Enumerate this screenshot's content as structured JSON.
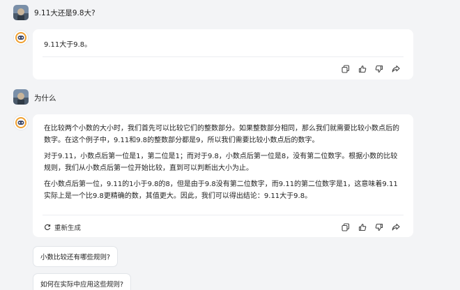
{
  "conversation": {
    "user_question_1": "9.11大还是9.8大?",
    "answer_1": "9.11大于9.8。",
    "user_question_2": "为什么",
    "answer_2": {
      "paragraphs": [
        "在比较两个小数的大小时，我们首先可以比较它们的整数部分。如果整数部分相同，那么我们就需要比较小数点后的数字。在这个例子中，9.11和9.8的整数部分都是9，所以我们需要比较小数点后的数字。",
        "对于9.11，小数点后第一位是1，第二位是1；而对于9.8，小数点后第一位是8，没有第二位数字。根据小数的比较规则，我们从小数点后第一位开始比较，直到可以判断出大小为止。",
        "在小数点后第一位，9.11的1小于9.8的8，但是由于9.8没有第二位数字，而9.11的第二位数字是1，这意味着9.11实际上是一个比9.8更精确的数，其值更大。因此，我们可以得出结论：9.11大于9.8。"
      ]
    },
    "regenerate_label": "重新生成"
  },
  "actions": {
    "icons": [
      "copy-icon",
      "thumbs-up-icon",
      "thumbs-down-icon",
      "share-icon"
    ]
  },
  "suggestions": [
    "小数比较还有哪些规则?",
    "如何在实际中应用这些规则?"
  ],
  "colors": {
    "background": "#f3f4f6",
    "card": "#ffffff",
    "bot_accent": "#f0a030",
    "bot_face": "#3f4a6a"
  }
}
